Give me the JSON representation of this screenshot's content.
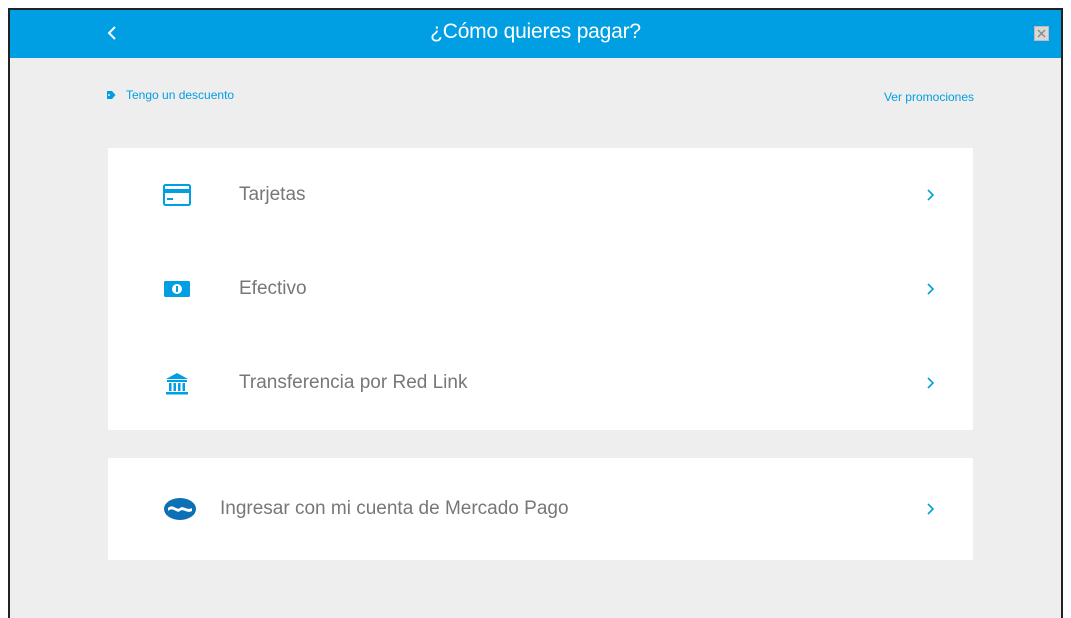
{
  "header": {
    "title": "¿Cómo quieres pagar?",
    "back_icon": "chevron-left-icon",
    "close_icon": "close-icon",
    "bg_color": "#009ee3"
  },
  "discount": {
    "label": "Tengo un descuento",
    "icon": "tag-icon"
  },
  "promotions": {
    "label": "Ver promociones"
  },
  "payment_methods": [
    {
      "label": "Tarjetas",
      "icon": "credit-card-icon"
    },
    {
      "label": "Efectivo",
      "icon": "cash-icon"
    },
    {
      "label": "Transferencia por Red Link",
      "icon": "bank-icon"
    }
  ],
  "mercadopago": {
    "label": "Ingresar con mi cuenta de Mercado Pago",
    "icon": "mercadopago-logo-icon"
  },
  "colors": {
    "accent": "#009ee3",
    "text_muted": "#777777",
    "page_bg": "#eeeeee"
  }
}
